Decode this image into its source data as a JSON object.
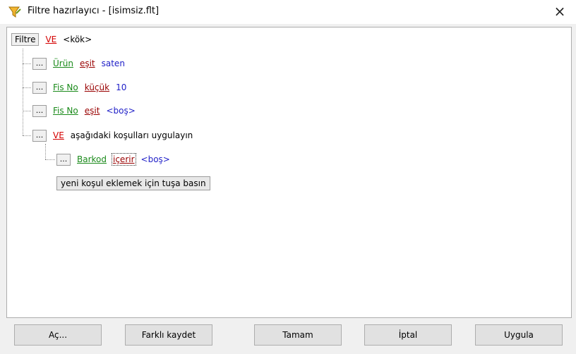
{
  "window": {
    "title": "Filtre hazırlayıcı - [isimsiz.flt]",
    "close": "×"
  },
  "tree": {
    "root": {
      "tag": "Filtre",
      "op": "VE",
      "label": "<kök>"
    },
    "conditions": [
      {
        "dots": "...",
        "field": "Ürün",
        "op": "eşit",
        "value": "saten"
      },
      {
        "dots": "...",
        "field": "Fis No",
        "op": "küçük",
        "value": "10"
      },
      {
        "dots": "...",
        "field": "Fis No",
        "op": "eşit",
        "value": "<boş>"
      }
    ],
    "group": {
      "dots": "...",
      "op": "VE",
      "label": "aşağıdaki koşulları uygulayın",
      "child": {
        "dots": "...",
        "field": "Barkod",
        "op": "içerir",
        "value": "<boş>"
      }
    },
    "add_button": "yeni koşul eklemek için tuşa basın"
  },
  "buttons": {
    "open": "Aç...",
    "save_as": "Farklı kaydet",
    "ok": "Tamam",
    "cancel": "İptal",
    "apply": "Uygula"
  }
}
